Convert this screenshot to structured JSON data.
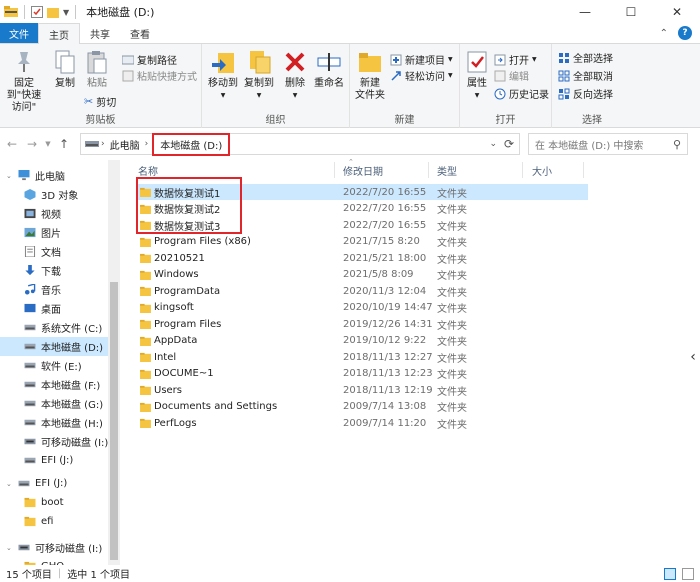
{
  "window": {
    "title": "本地磁盘 (D:)",
    "controls": {
      "minimize": "—",
      "maximize": "☐",
      "close": "✕"
    }
  },
  "tabs": {
    "file": "文件",
    "items": [
      "主页",
      "共享",
      "查看"
    ],
    "active": "主页"
  },
  "ribbon": {
    "clipboard": {
      "label": "剪贴板",
      "pin": "固定到\"快速访问\"",
      "copy": "复制",
      "paste": "粘贴",
      "copy_path": "复制路径",
      "paste_shortcut": "粘贴快捷方式",
      "cut": "剪切"
    },
    "organize": {
      "label": "组织",
      "move_to": "移动到",
      "copy_to": "复制到",
      "delete": "删除",
      "rename": "重命名"
    },
    "new": {
      "label": "新建",
      "new_folder": "新建\n文件夹",
      "new_item": "新建项目",
      "easy_access": "轻松访问"
    },
    "open": {
      "label": "打开",
      "properties": "属性",
      "open": "打开",
      "edit": "编辑",
      "history": "历史记录"
    },
    "select": {
      "label": "选择",
      "select_all": "全部选择",
      "select_none": "全部取消",
      "invert": "反向选择"
    }
  },
  "address": {
    "root": "此电脑",
    "current": "本地磁盘 (D:)",
    "search_placeholder": "在 本地磁盘 (D:) 中搜索"
  },
  "nav": [
    {
      "label": "此电脑",
      "icon": "pc-icon",
      "indent": 0
    },
    {
      "label": "3D 对象",
      "icon": "3d-icon",
      "indent": 1
    },
    {
      "label": "视频",
      "icon": "video-icon",
      "indent": 1
    },
    {
      "label": "图片",
      "icon": "picture-icon",
      "indent": 1
    },
    {
      "label": "文档",
      "icon": "document-icon",
      "indent": 1
    },
    {
      "label": "下载",
      "icon": "download-icon",
      "indent": 1
    },
    {
      "label": "音乐",
      "icon": "music-icon",
      "indent": 1
    },
    {
      "label": "桌面",
      "icon": "desktop-icon",
      "indent": 1
    },
    {
      "label": "系统文件 (C:)",
      "icon": "drive-icon",
      "indent": 1
    },
    {
      "label": "本地磁盘 (D:)",
      "icon": "drive-icon",
      "indent": 1,
      "selected": true
    },
    {
      "label": "软件 (E:)",
      "icon": "drive-icon",
      "indent": 1
    },
    {
      "label": "本地磁盘 (F:)",
      "icon": "drive-icon",
      "indent": 1
    },
    {
      "label": "本地磁盘 (G:)",
      "icon": "drive-icon",
      "indent": 1
    },
    {
      "label": "本地磁盘 (H:)",
      "icon": "drive-icon",
      "indent": 1
    },
    {
      "label": "可移动磁盘 (I:)",
      "icon": "usb-drive-icon",
      "indent": 1
    },
    {
      "label": "EFI (J:)",
      "icon": "drive-icon",
      "indent": 1
    },
    {
      "label": "EFI (J:)",
      "icon": "drive-icon",
      "indent": 0
    },
    {
      "label": "boot",
      "icon": "folder-icon",
      "indent": 1
    },
    {
      "label": "efi",
      "icon": "folder-icon",
      "indent": 1
    },
    {
      "label": "可移动磁盘 (I:)",
      "icon": "usb-drive-icon",
      "indent": 0
    },
    {
      "label": "GHO",
      "icon": "folder-icon",
      "indent": 1
    }
  ],
  "columns": {
    "name": "名称",
    "date": "修改日期",
    "type": "类型",
    "size": "大小"
  },
  "files": [
    {
      "name": "数据恢复测试1",
      "date": "2022/7/20 16:55",
      "type": "文件夹",
      "selected": true
    },
    {
      "name": "数据恢复测试2",
      "date": "2022/7/20 16:55",
      "type": "文件夹"
    },
    {
      "name": "数据恢复测试3",
      "date": "2022/7/20 16:55",
      "type": "文件夹"
    },
    {
      "name": "Program Files (x86)",
      "date": "2021/7/15 8:20",
      "type": "文件夹"
    },
    {
      "name": "20210521",
      "date": "2021/5/21 18:00",
      "type": "文件夹"
    },
    {
      "name": "Windows",
      "date": "2021/5/8 8:09",
      "type": "文件夹"
    },
    {
      "name": "ProgramData",
      "date": "2020/11/3 12:04",
      "type": "文件夹"
    },
    {
      "name": "kingsoft",
      "date": "2020/10/19 14:47",
      "type": "文件夹"
    },
    {
      "name": "Program Files",
      "date": "2019/12/26 14:31",
      "type": "文件夹"
    },
    {
      "name": "AppData",
      "date": "2019/10/12 9:22",
      "type": "文件夹"
    },
    {
      "name": "Intel",
      "date": "2018/11/13 12:27",
      "type": "文件夹"
    },
    {
      "name": "DOCUME~1",
      "date": "2018/11/13 12:23",
      "type": "文件夹"
    },
    {
      "name": "Users",
      "date": "2018/11/13 12:19",
      "type": "文件夹"
    },
    {
      "name": "Documents and Settings",
      "date": "2009/7/14 13:08",
      "type": "文件夹"
    },
    {
      "name": "PerfLogs",
      "date": "2009/7/14 11:20",
      "type": "文件夹"
    }
  ],
  "status": {
    "count": "15 个项目",
    "selected": "选中 1 个项目"
  },
  "colors": {
    "accent": "#1979ca",
    "selection": "#cce8ff",
    "highlight": "#e0262b",
    "folder": "#f5c542"
  }
}
